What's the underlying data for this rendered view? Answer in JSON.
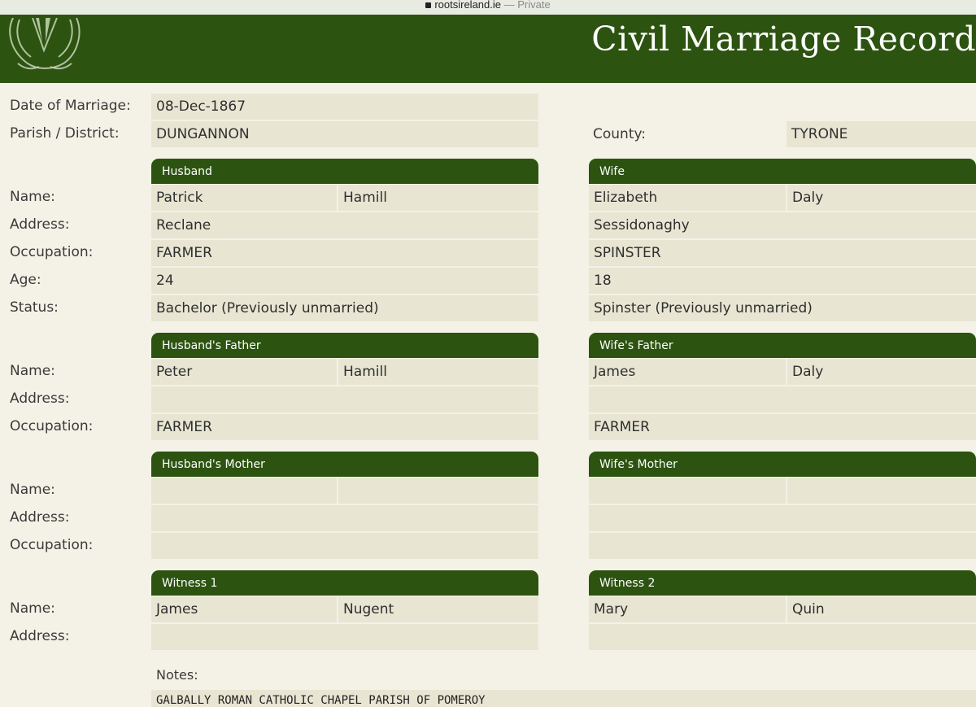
{
  "browser": {
    "host": "rootsireland.ie",
    "mode": " — Private"
  },
  "header": {
    "title": "Civil Marriage Record"
  },
  "labels": {
    "date_of_marriage": "Date of Marriage:",
    "parish": "Parish / District:",
    "county": "County:",
    "name": "Name:",
    "address": "Address:",
    "occupation": "Occupation:",
    "age": "Age:",
    "status": "Status:",
    "notes": "Notes:"
  },
  "record": {
    "date": "08-Dec-1867",
    "parish": "DUNGANNON",
    "county": "TYRONE",
    "notes": "GALBALLY ROMAN CATHOLIC CHAPEL PARISH OF POMEROY"
  },
  "husband": {
    "heading": "Husband",
    "first_name": "Patrick",
    "last_name": "Hamill",
    "address": "Reclane",
    "occupation": "FARMER",
    "age": "24",
    "status": "Bachelor (Previously unmarried)"
  },
  "wife": {
    "heading": "Wife",
    "first_name": "Elizabeth",
    "last_name": "Daly",
    "address": "Sessidonaghy",
    "occupation": "SPINSTER",
    "age": "18",
    "status": "Spinster (Previously unmarried)"
  },
  "husband_father": {
    "heading": "Husband's Father",
    "first_name": "Peter",
    "last_name": "Hamill",
    "address": "",
    "occupation": "FARMER"
  },
  "wife_father": {
    "heading": "Wife's Father",
    "first_name": "James",
    "last_name": "Daly",
    "address": "",
    "occupation": "FARMER"
  },
  "husband_mother": {
    "heading": "Husband's Mother",
    "first_name": "",
    "last_name": "",
    "address": "",
    "occupation": ""
  },
  "wife_mother": {
    "heading": "Wife's Mother",
    "first_name": "",
    "last_name": "",
    "address": "",
    "occupation": ""
  },
  "witness1": {
    "heading": "Witness 1",
    "first_name": "James",
    "last_name": "Nugent",
    "address": ""
  },
  "witness2": {
    "heading": "Witness 2",
    "first_name": "Mary",
    "last_name": "Quin",
    "address": ""
  },
  "colors": {
    "header_green": "#2c5310",
    "field_bg": "#e8e6d3",
    "page_bg": "#f4f2e6"
  },
  "icons": {
    "logo": "harp-logo-icon",
    "lock": "lock-icon"
  }
}
